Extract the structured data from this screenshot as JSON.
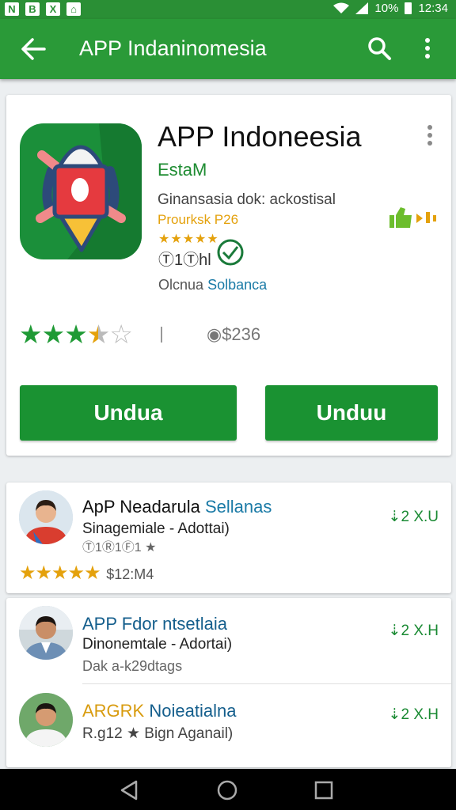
{
  "status_bar": {
    "notification_icons": [
      "N",
      "B",
      "X",
      "⌂"
    ],
    "battery_text": "10%",
    "time": "12:34"
  },
  "app_bar": {
    "title": "APP Indaninomesia"
  },
  "app": {
    "title": "APP Indoneesia",
    "developer": "EstaM",
    "description": "Ginansasia dok: ackostisal",
    "category": "Prourksk P26",
    "small_stars": "★★★★★",
    "size_label": "Ⓣ1Ⓣhl",
    "publisher_a": "Olcnua",
    "publisher_b": "Solbanca",
    "rating": 3.5,
    "divider": "I",
    "download_count": "◉$236",
    "install_left_label": "Undua",
    "install_right_label": "Unduu"
  },
  "list": {
    "items": [
      {
        "title_a": "ApP Neadarula",
        "title_b": "Sellanas",
        "subtitle": "Sinagemiale - Adottai)",
        "meta": "Ⓣ1Ⓡ1Ⓕ1 ★",
        "size": "⇣2 X.U",
        "stars": "★★★★★",
        "rating_text": "$12:M4"
      },
      {
        "title": "APP Fdor ntsetlaia",
        "subtitle": "Dinonemtale - Adortai)",
        "meta": "Dak a-k29dtags",
        "size": "⇣2 X.H"
      },
      {
        "title_a": "ARGRK",
        "title_b": "Noieatialna",
        "subtitle": "R.g12 ★ Bign Aganail)",
        "size": "⇣2 X.H"
      }
    ]
  },
  "colors": {
    "primary": "#2a9a38",
    "status_bar": "#2a8f35",
    "button": "#1a9232",
    "star": "#e4a10c"
  }
}
